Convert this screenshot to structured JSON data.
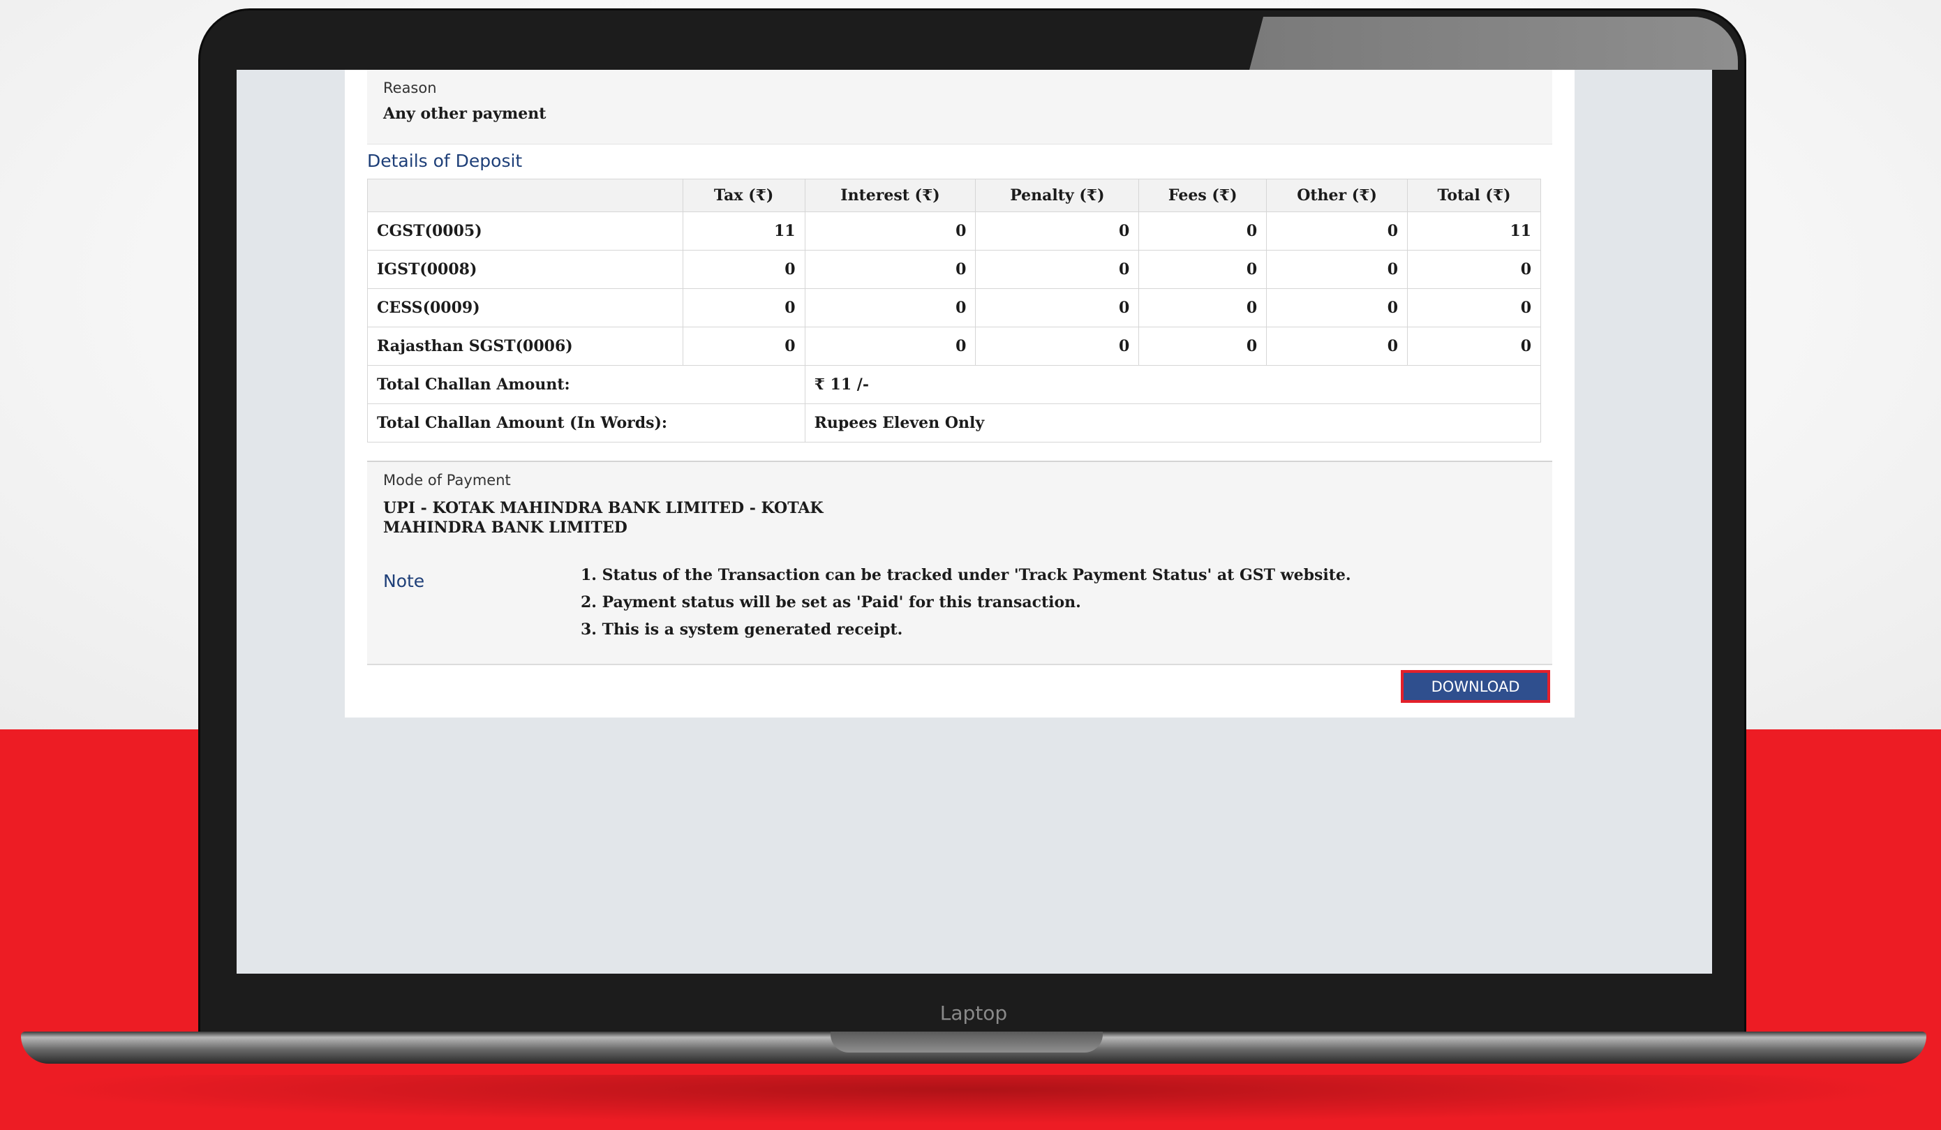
{
  "laptop_label": "Laptop",
  "reason": {
    "label": "Reason",
    "value": "Any other payment"
  },
  "deposit": {
    "title": "Details of Deposit",
    "headers": [
      "",
      "Tax (₹)",
      "Interest (₹)",
      "Penalty (₹)",
      "Fees (₹)",
      "Other (₹)",
      "Total (₹)"
    ],
    "rows": [
      {
        "name": "CGST(0005)",
        "values": [
          "11",
          "0",
          "0",
          "0",
          "0",
          "11"
        ]
      },
      {
        "name": "IGST(0008)",
        "values": [
          "0",
          "0",
          "0",
          "0",
          "0",
          "0"
        ]
      },
      {
        "name": "CESS(0009)",
        "values": [
          "0",
          "0",
          "0",
          "0",
          "0",
          "0"
        ]
      },
      {
        "name": "Rajasthan SGST(0006)",
        "values": [
          "0",
          "0",
          "0",
          "0",
          "0",
          "0"
        ]
      }
    ],
    "total_label": "Total Challan Amount:",
    "total_value": "₹ 11 /-",
    "words_label": "Total Challan Amount (In Words):",
    "words_value": "Rupees Eleven Only"
  },
  "payment": {
    "label": "Mode of Payment",
    "value": "UPI - KOTAK MAHINDRA BANK LIMITED - KOTAK MAHINDRA BANK LIMITED"
  },
  "note": {
    "title": "Note",
    "items": [
      "1. Status of the Transaction can be tracked under 'Track Payment Status' at GST website.",
      "2. Payment status will be set as 'Paid' for this transaction.",
      "3. This is a system generated receipt."
    ]
  },
  "download_label": "DOWNLOAD",
  "colors": {
    "accent": "#2f4f8e",
    "highlight": "#e3202a",
    "background_red": "#ed1c24"
  }
}
